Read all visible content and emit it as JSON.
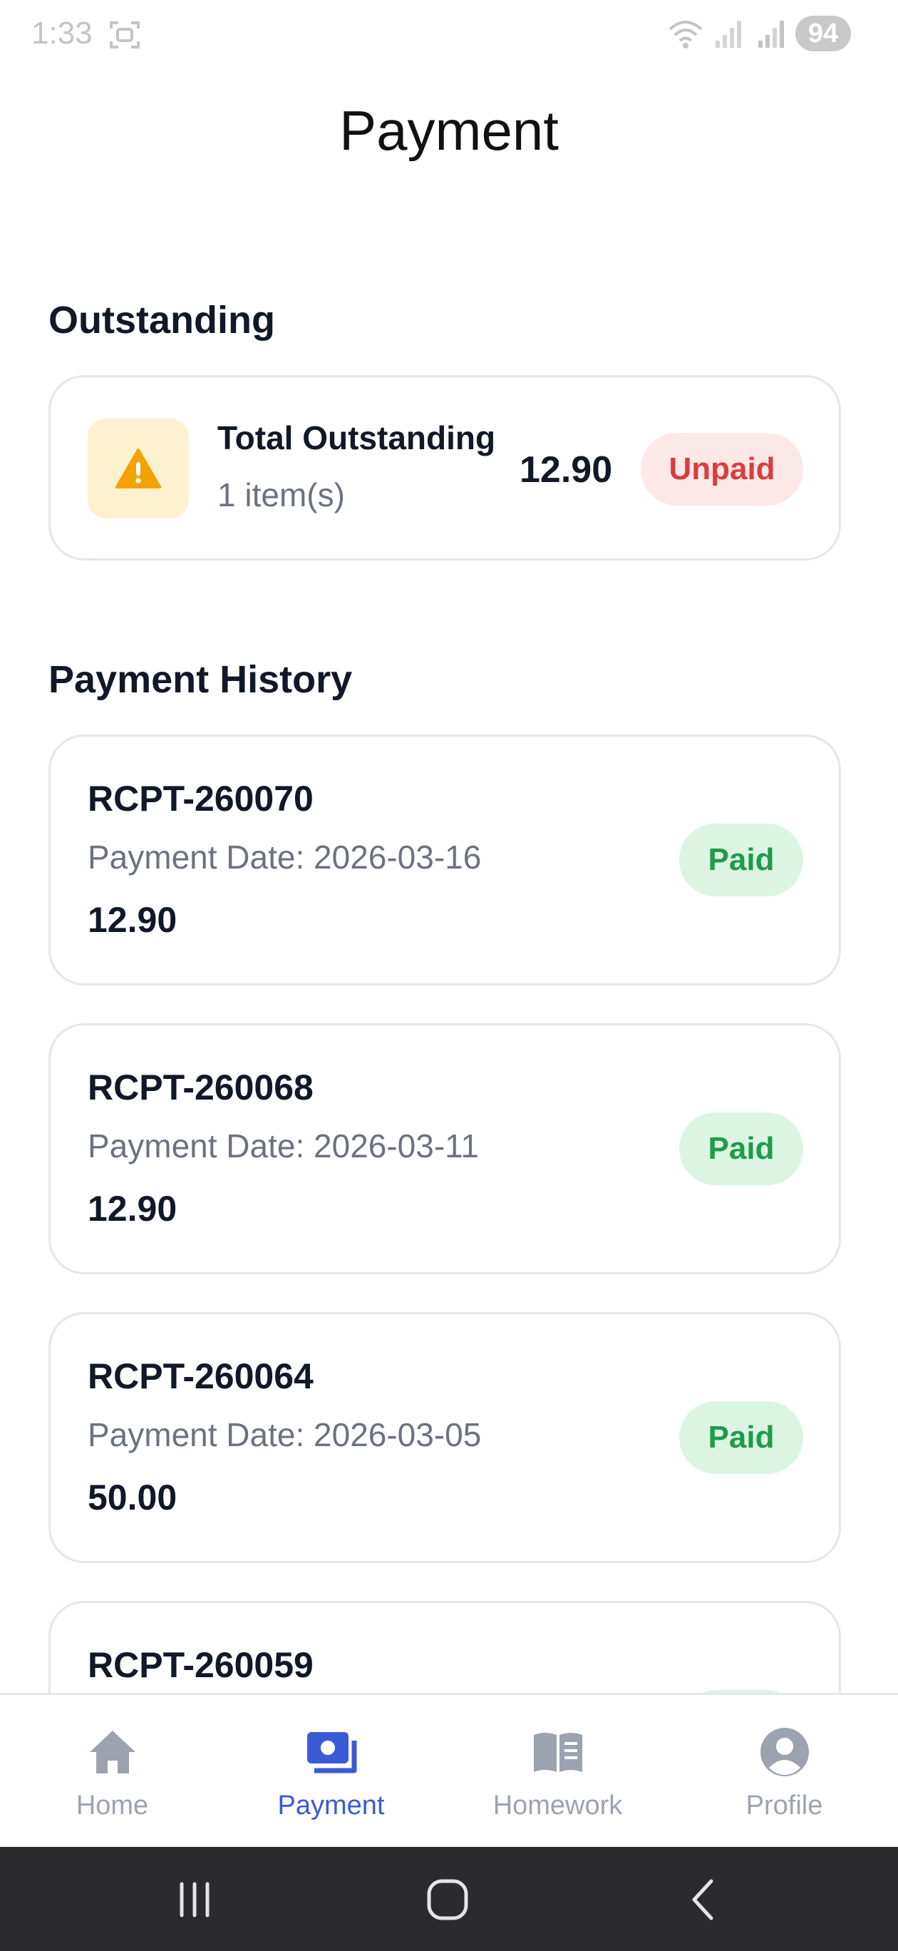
{
  "status_bar": {
    "time": "1:33",
    "battery": "94"
  },
  "page": {
    "title": "Payment"
  },
  "outstanding": {
    "heading": "Outstanding",
    "title": "Total Outstanding",
    "subtitle": "1 item(s)",
    "amount": "12.90",
    "status": "Unpaid",
    "icon": "warning-icon"
  },
  "history": {
    "heading": "Payment History",
    "items": [
      {
        "receipt": "RCPT-260070",
        "date": "Payment Date: 2026-03-16",
        "amount": "12.90",
        "status": "Paid"
      },
      {
        "receipt": "RCPT-260068",
        "date": "Payment Date: 2026-03-11",
        "amount": "12.90",
        "status": "Paid"
      },
      {
        "receipt": "RCPT-260064",
        "date": "Payment Date: 2026-03-05",
        "amount": "50.00",
        "status": "Paid"
      },
      {
        "receipt": "RCPT-260059"
      }
    ]
  },
  "nav": {
    "items": [
      {
        "label": "Home",
        "icon": "home-icon"
      },
      {
        "label": "Payment",
        "icon": "payment-icon",
        "active": true
      },
      {
        "label": "Homework",
        "icon": "book-icon"
      },
      {
        "label": "Profile",
        "icon": "profile-icon"
      }
    ]
  },
  "colors": {
    "accent": "#3b5bd6",
    "unpaid": "#dc3c3c",
    "paid": "#1f9b4a",
    "warning": "#f2a300"
  }
}
